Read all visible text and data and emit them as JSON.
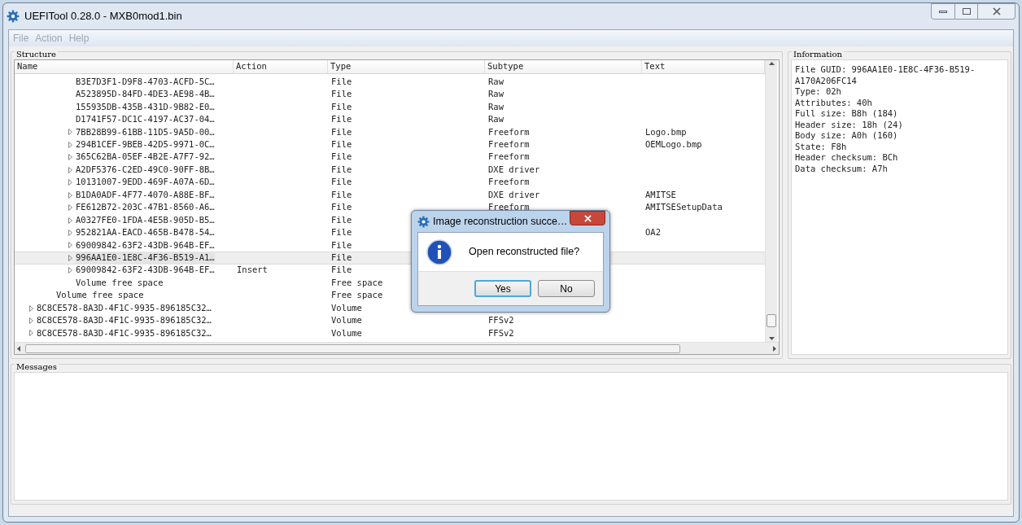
{
  "window": {
    "title": "UEFITool 0.28.0 - MXB0mod1.bin"
  },
  "menu": [
    {
      "label": "File",
      "disabled": true
    },
    {
      "label": "Action",
      "disabled": true
    },
    {
      "label": "Help",
      "disabled": true
    }
  ],
  "structure": {
    "title": "Structure",
    "columns": [
      "Name",
      "Action",
      "Type",
      "Subtype",
      "Text"
    ],
    "tree": [
      {
        "children": [
          {
            "children": [
              {
                "name": "B3E7D3F1-D9F8-4703-ACFD-5C…",
                "type": "File",
                "subtype": "Raw",
                "expandable": false,
                "selected": false
              },
              {
                "name": "A523895D-84FD-4DE3-AE98-4B…",
                "type": "File",
                "subtype": "Raw",
                "expandable": false,
                "selected": false
              },
              {
                "name": "155935DB-435B-431D-9B82-E0…",
                "type": "File",
                "subtype": "Raw",
                "expandable": false,
                "selected": false
              },
              {
                "name": "D1741F57-DC1C-4197-AC37-04…",
                "type": "File",
                "subtype": "Raw",
                "expandable": false,
                "selected": false
              },
              {
                "name": "7BB28B99-61BB-11D5-9A5D-00…",
                "type": "File",
                "subtype": "Freeform",
                "text": "Logo.bmp",
                "expandable": true,
                "selected": false
              },
              {
                "name": "294B1CEF-9BEB-42D5-9971-0C…",
                "type": "File",
                "subtype": "Freeform",
                "text": "OEMLogo.bmp",
                "expandable": true,
                "selected": false
              },
              {
                "name": "365C62BA-05EF-4B2E-A7F7-92…",
                "type": "File",
                "subtype": "Freeform",
                "expandable": true,
                "selected": false
              },
              {
                "name": "A2DF5376-C2ED-49C0-90FF-8B…",
                "type": "File",
                "subtype": "DXE driver",
                "expandable": true,
                "selected": false
              },
              {
                "name": "10131007-9EDD-469F-A07A-6D…",
                "type": "File",
                "subtype": "Freeform",
                "expandable": true,
                "selected": false
              },
              {
                "name": "B1DA0ADF-4F77-4070-A88E-BF…",
                "type": "File",
                "subtype": "DXE driver",
                "text": "AMITSE",
                "expandable": true,
                "selected": false
              },
              {
                "name": "FE612B72-203C-47B1-8560-A6…",
                "type": "File",
                "subtype": "Freeform",
                "text": "AMITSESetupData",
                "expandable": true,
                "selected": false
              },
              {
                "name": "A0327FE0-1FDA-4E5B-905D-B5…",
                "type": "File",
                "expandable": true,
                "selected": false
              },
              {
                "name": "952821AA-EACD-465B-B478-54…",
                "type": "File",
                "text": "OA2",
                "expandable": true,
                "selected": false
              },
              {
                "name": "69009842-63F2-43DB-964B-EF…",
                "type": "File",
                "expandable": true,
                "selected": false
              },
              {
                "name": "996AA1E0-1E8C-4F36-B519-A1…",
                "type": "File",
                "expandable": true,
                "selected": true
              },
              {
                "name": "69009842-63F2-43DB-964B-EF…",
                "action": "Insert",
                "type": "File",
                "expandable": true,
                "selected": false
              },
              {
                "name": "Volume free space",
                "type": "Free space",
                "expandable": false,
                "selected": false
              }
            ]
          },
          {
            "name": "Volume free space",
            "type": "Free space",
            "expandable": false,
            "selected": false
          }
        ]
      },
      {
        "name": "8C8CE578-8A3D-4F1C-9935-896185C32…",
        "type": "Volume",
        "expandable": true,
        "selected": false
      },
      {
        "name": "8C8CE578-8A3D-4F1C-9935-896185C32…",
        "type": "Volume",
        "subtype": "FFSv2",
        "expandable": true,
        "selected": false
      },
      {
        "name": "8C8CE578-8A3D-4F1C-9935-896185C32…",
        "type": "Volume",
        "subtype": "FFSv2",
        "expandable": true,
        "selected": false
      }
    ]
  },
  "information": {
    "title": "Information",
    "lines": [
      "File GUID: 996AA1E0-1E8C-4F36-B519-",
      "A170A206FC14",
      "Type: 02h",
      "Attributes: 40h",
      "Full size: B8h (184)",
      "Header size: 18h (24)",
      "Body size: A0h (160)",
      "State: F8h",
      "Header checksum: BCh",
      "Data checksum: A7h"
    ]
  },
  "messages": {
    "title": "Messages"
  },
  "dialog": {
    "title": "Image reconstruction succe…",
    "message": "Open reconstructed file?",
    "buttons": [
      {
        "label": "Yes",
        "default": true
      },
      {
        "label": "No",
        "default": false
      }
    ]
  }
}
